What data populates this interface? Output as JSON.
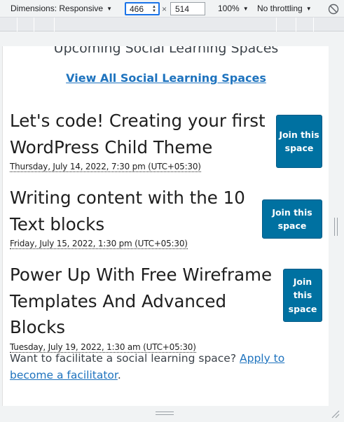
{
  "devtools": {
    "dimensions_label": "Dimensions: Responsive",
    "width_value": "466",
    "times": "×",
    "height_value": "514",
    "zoom": "100%",
    "throttling": "No throttling"
  },
  "page": {
    "heading": "Upcoming Social Learning Spaces",
    "view_all_link": "View All Social Learning Spaces",
    "events": [
      {
        "title": "Let's code! Creating your first WordPress Child Theme",
        "date": "Thursday, July 14, 2022, 7:30 pm (UTC+05:30)",
        "join_label": "Join this space"
      },
      {
        "title": "Writing content with the 10 Text blocks",
        "date": "Friday, July 15, 2022, 1:30 pm (UTC+05:30)",
        "join_label": "Join this space"
      },
      {
        "title": "Power Up With Free Wireframe Templates And Advanced Blocks",
        "date": "Tuesday, July 19, 2022, 1:30 am (UTC+05:30)",
        "join_label": "Join this space"
      }
    ],
    "facilitate_text": "Want to facilitate a social learning space? ",
    "facilitate_link": "Apply to become a facilitator",
    "facilitate_end": "."
  },
  "colors": {
    "accent": "#0071a1",
    "link": "#1e73be",
    "focus": "#1a73e8"
  }
}
